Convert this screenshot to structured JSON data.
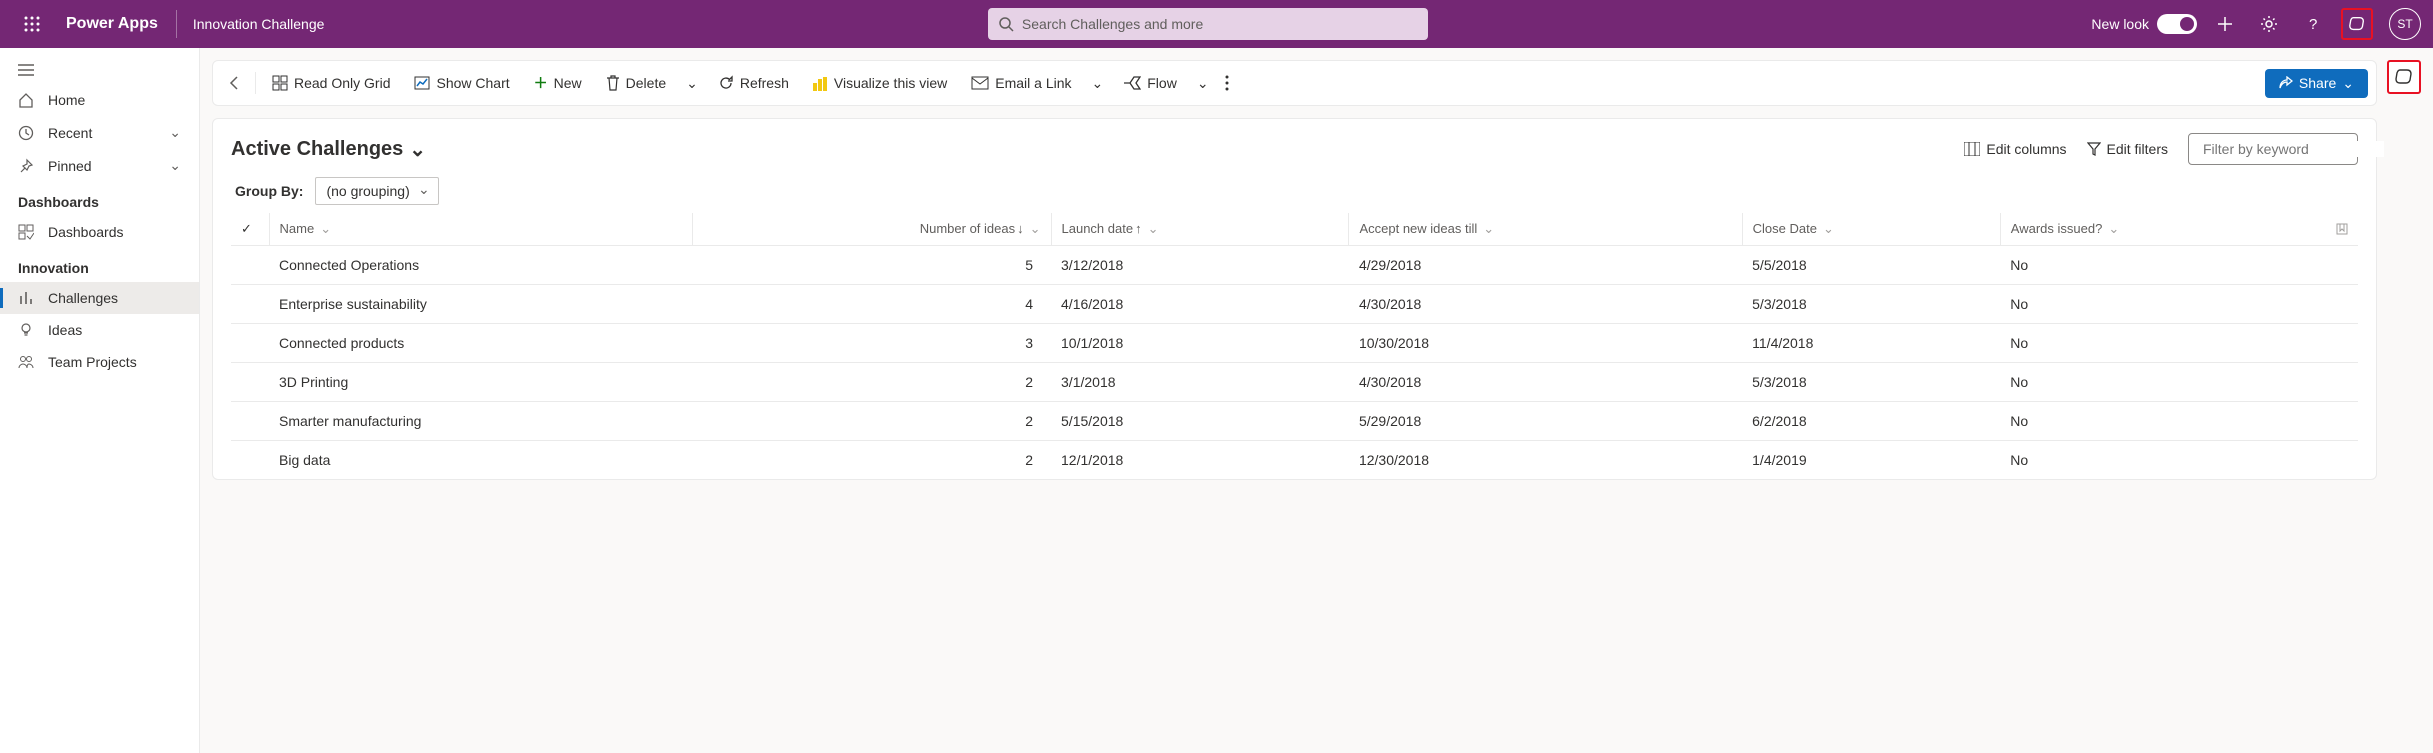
{
  "header": {
    "app_name": "Power Apps",
    "app_title": "Innovation Challenge",
    "search_placeholder": "Search Challenges and more",
    "new_look_label": "New look",
    "avatar_initials": "ST"
  },
  "sidebar": {
    "home": "Home",
    "recent": "Recent",
    "pinned": "Pinned",
    "group_dashboards": "Dashboards",
    "dashboards_item": "Dashboards",
    "group_innovation": "Innovation",
    "challenges": "Challenges",
    "ideas": "Ideas",
    "team_projects": "Team Projects"
  },
  "commandbar": {
    "read_only_grid": "Read Only Grid",
    "show_chart": "Show Chart",
    "new": "New",
    "delete": "Delete",
    "refresh": "Refresh",
    "visualize": "Visualize this view",
    "email": "Email a Link",
    "flow": "Flow",
    "share": "Share"
  },
  "view": {
    "title": "Active Challenges",
    "edit_columns": "Edit columns",
    "edit_filters": "Edit filters",
    "filter_placeholder": "Filter by keyword",
    "group_by_label": "Group By:",
    "group_by_value": "(no grouping)"
  },
  "columns": {
    "name": "Name",
    "num_ideas": "Number of ideas",
    "launch_date": "Launch date",
    "accept_until": "Accept new ideas till",
    "close_date": "Close Date",
    "awards_issued": "Awards issued?"
  },
  "rows": [
    {
      "name": "Connected Operations",
      "ideas": "5",
      "launch": "3/12/2018",
      "accept": "4/29/2018",
      "close": "5/5/2018",
      "awards": "No"
    },
    {
      "name": "Enterprise sustainability",
      "ideas": "4",
      "launch": "4/16/2018",
      "accept": "4/30/2018",
      "close": "5/3/2018",
      "awards": "No"
    },
    {
      "name": "Connected products",
      "ideas": "3",
      "launch": "10/1/2018",
      "accept": "10/30/2018",
      "close": "11/4/2018",
      "awards": "No"
    },
    {
      "name": "3D Printing",
      "ideas": "2",
      "launch": "3/1/2018",
      "accept": "4/30/2018",
      "close": "5/3/2018",
      "awards": "No"
    },
    {
      "name": "Smarter manufacturing",
      "ideas": "2",
      "launch": "5/15/2018",
      "accept": "5/29/2018",
      "close": "6/2/2018",
      "awards": "No"
    },
    {
      "name": "Big data",
      "ideas": "2",
      "launch": "12/1/2018",
      "accept": "12/30/2018",
      "close": "1/4/2019",
      "awards": "No"
    }
  ]
}
